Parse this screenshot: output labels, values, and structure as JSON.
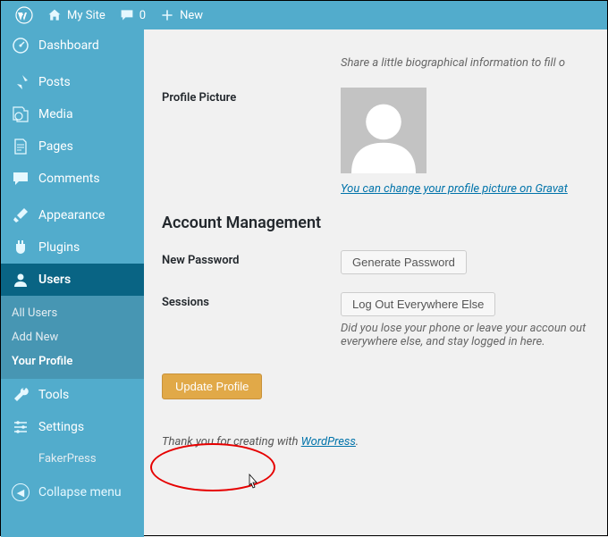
{
  "adminbar": {
    "site": "My Site",
    "comments": "0",
    "new": "New"
  },
  "sidebar": {
    "items": [
      {
        "label": "Dashboard"
      },
      {
        "label": "Posts"
      },
      {
        "label": "Media"
      },
      {
        "label": "Pages"
      },
      {
        "label": "Comments"
      },
      {
        "label": "Appearance"
      },
      {
        "label": "Plugins"
      },
      {
        "label": "Users"
      },
      {
        "label": "Tools"
      },
      {
        "label": "Settings"
      },
      {
        "label": "FakerPress"
      }
    ],
    "submenu": {
      "all": "All Users",
      "add": "Add New",
      "profile": "Your Profile"
    },
    "collapse": "Collapse menu"
  },
  "profile": {
    "bio_desc": "Share a little biographical information to fill o",
    "picture_label": "Profile Picture",
    "gravatar_link": "You can change your profile picture on Gravat",
    "account_heading": "Account Management",
    "newpass_label": "New Password",
    "genpass_btn": "Generate Password",
    "sessions_label": "Sessions",
    "logout_btn": "Log Out Everywhere Else",
    "sessions_desc": "Did you lose your phone or leave your accoun out everywhere else, and stay logged in here.",
    "update_btn": "Update Profile",
    "footer_pre": "Thank you for creating with ",
    "footer_link": "WordPress",
    "footer_post": "."
  }
}
